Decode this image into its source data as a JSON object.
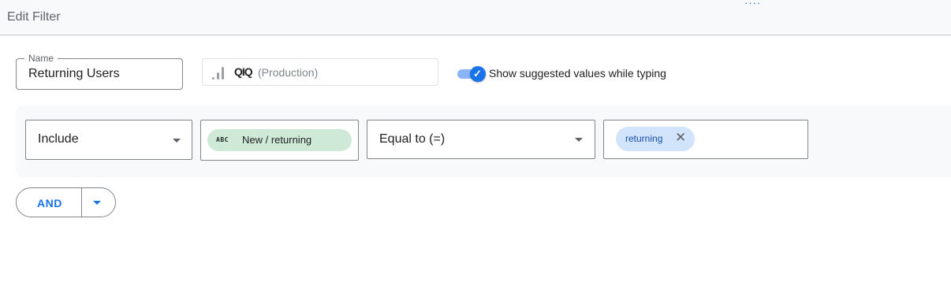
{
  "header": {
    "title": "Edit Filter",
    "menu_icon": "more-dots-icon"
  },
  "name_field": {
    "label": "Name",
    "value": "Returning Users"
  },
  "data_source": {
    "mask": "QIQ",
    "value": "(Production)",
    "icon": "analytics-bars-icon"
  },
  "suggest_toggle": {
    "checked": true,
    "label": "Show suggested values while typing"
  },
  "condition": {
    "include_mode": "Include",
    "dimension": {
      "type_badge": "ABC",
      "label": "New / returning"
    },
    "operator": "Equal to (=)",
    "value_chip": {
      "label": "returning",
      "remove_symbol": "✕"
    }
  },
  "logic": {
    "and_label": "AND"
  },
  "colors": {
    "accent": "#1a73e8",
    "chip_green": "#ceead6",
    "chip_blue": "#d2e3fc"
  }
}
